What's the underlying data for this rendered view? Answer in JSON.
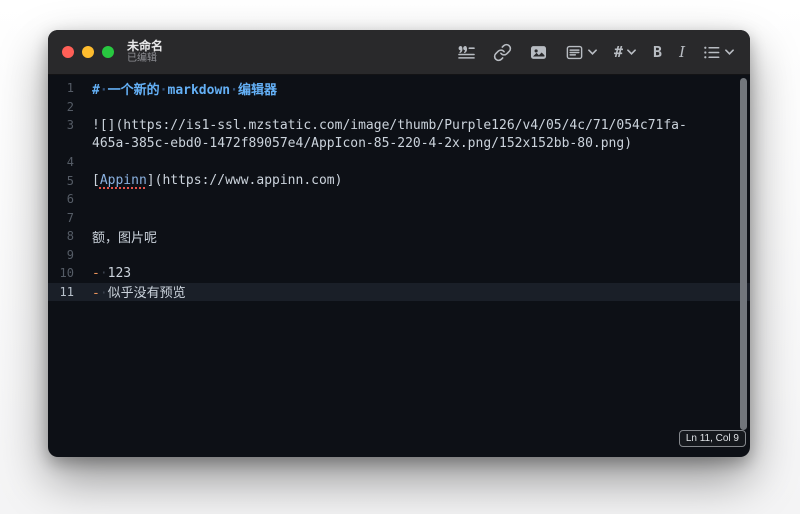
{
  "window": {
    "title": "未命名",
    "subtitle": "已编辑"
  },
  "toolbar": {
    "items": [
      {
        "name": "blockquote-icon",
        "glyph": ""
      },
      {
        "name": "link-icon",
        "glyph": ""
      },
      {
        "name": "image-icon",
        "glyph": ""
      },
      {
        "name": "insert-block-icon",
        "glyph": "",
        "has_dropdown": true
      },
      {
        "name": "heading-icon",
        "glyph": "#",
        "has_dropdown": true
      },
      {
        "name": "bold-icon",
        "glyph": "B"
      },
      {
        "name": "italic-icon",
        "glyph": "I"
      },
      {
        "name": "list-icon",
        "glyph": "",
        "has_dropdown": true
      }
    ]
  },
  "editor": {
    "rows": [
      {
        "num": "1",
        "segments": [
          {
            "c": "heading",
            "t": "#"
          },
          {
            "c": "ws-h",
            "t": "·"
          },
          {
            "c": "heading",
            "t": "一个新的"
          },
          {
            "c": "ws-h",
            "t": "·"
          },
          {
            "c": "heading",
            "t": "markdown"
          },
          {
            "c": "ws-h",
            "t": "·"
          },
          {
            "c": "heading",
            "t": "编辑器"
          }
        ]
      },
      {
        "num": "2",
        "segments": []
      },
      {
        "num": "3",
        "segments": [
          {
            "c": "text",
            "t": "![](https://is1-ssl.mzstatic.com/image/thumb/Purple126/v4/05/4c/71/054c71fa-"
          }
        ]
      },
      {
        "num": "",
        "segments": [
          {
            "c": "text",
            "t": "465a-385c-ebd0-1472f89057e4/AppIcon-85-220-4-2x.png/152x152bb-80.png)"
          }
        ]
      },
      {
        "num": "4",
        "segments": []
      },
      {
        "num": "5",
        "segments": [
          {
            "c": "text",
            "t": "["
          },
          {
            "c": "link-misspelled",
            "t": "Appinn"
          },
          {
            "c": "text",
            "t": "](https://www.appinn.com)"
          }
        ]
      },
      {
        "num": "6",
        "segments": []
      },
      {
        "num": "7",
        "segments": []
      },
      {
        "num": "8",
        "segments": [
          {
            "c": "text",
            "t": "额，图片呢"
          }
        ]
      },
      {
        "num": "9",
        "segments": []
      },
      {
        "num": "10",
        "segments": [
          {
            "c": "marker",
            "t": "-"
          },
          {
            "c": "ws",
            "t": "·"
          },
          {
            "c": "text",
            "t": "123"
          }
        ]
      },
      {
        "num": "11",
        "active": true,
        "segments": [
          {
            "c": "marker",
            "t": "-"
          },
          {
            "c": "ws",
            "t": "·"
          },
          {
            "c": "text",
            "t": "似乎没有预览"
          }
        ]
      }
    ]
  },
  "status": {
    "position": "Ln 11, Col 9"
  },
  "colors": {
    "accent_heading": "#64b0f6",
    "accent_link": "#8ab1e0",
    "accent_marker": "#e8925a",
    "editor_bg": "#0d1016",
    "titlebar_bg": "#29292b",
    "current_line_bg": "#1a1f28",
    "traffic_red": "#ff5f57",
    "traffic_yellow": "#febc2e",
    "traffic_green": "#28c840"
  }
}
